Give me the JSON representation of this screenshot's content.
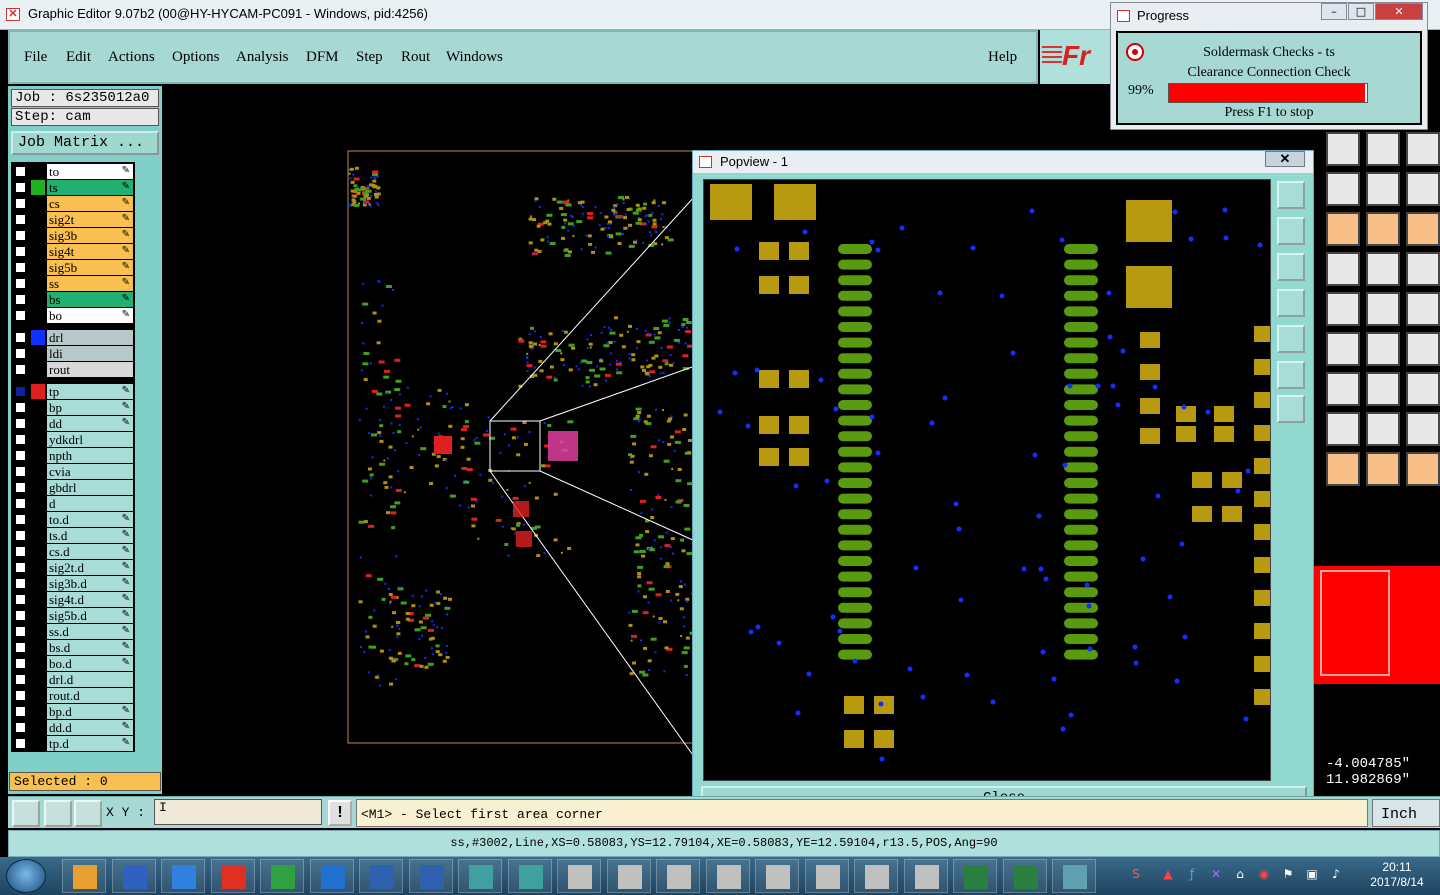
{
  "window": {
    "title": "Graphic Editor 9.07b2 (00@HY-HYCAM-PC091 - Windows, pid:4256)"
  },
  "menu": {
    "items": [
      {
        "label": "File"
      },
      {
        "label": "Edit"
      },
      {
        "label": "Actions"
      },
      {
        "label": "Options"
      },
      {
        "label": "Analysis"
      },
      {
        "label": "DFM"
      },
      {
        "label": "Step"
      },
      {
        "label": "Rout"
      },
      {
        "label": "Windows"
      }
    ],
    "help": "Help",
    "logo": "Fr"
  },
  "job": {
    "job_line": "Job : 6s235012a0",
    "step_line": "Step: cam",
    "job_matrix": "Job Matrix ..."
  },
  "layers": [
    {
      "name": "to",
      "color": "#ffffff",
      "swatch": "#000000",
      "pen": true
    },
    {
      "name": "ts",
      "color": "#20b070",
      "swatch": "#20b020",
      "pen": true
    },
    {
      "name": "cs",
      "color": "#f8c050",
      "swatch": "#000000",
      "pen": true
    },
    {
      "name": "sig2t",
      "color": "#f8c050",
      "swatch": "#000000",
      "pen": true
    },
    {
      "name": "sig3b",
      "color": "#f8c050",
      "swatch": "#000000",
      "pen": true
    },
    {
      "name": "sig4t",
      "color": "#f8c050",
      "swatch": "#000000",
      "pen": true
    },
    {
      "name": "sig5b",
      "color": "#f8c050",
      "swatch": "#000000",
      "pen": true
    },
    {
      "name": "ss",
      "color": "#f8c050",
      "swatch": "#000000",
      "pen": true
    },
    {
      "name": "bs",
      "color": "#20b070",
      "swatch": "#000000",
      "pen": true
    },
    {
      "name": "bo",
      "color": "#ffffff",
      "swatch": "#000000",
      "pen": true
    },
    {
      "name": "drl",
      "color": "#b8c8c8",
      "swatch": "#1030ff",
      "pen": false,
      "gap": true
    },
    {
      "name": "ldi",
      "color": "#b8c8c8",
      "swatch": "#000000",
      "pen": false
    },
    {
      "name": "rout",
      "color": "#d8d8d8",
      "swatch": "#000000",
      "pen": false
    },
    {
      "name": "tp",
      "color": "#a8dcd6",
      "swatch": "#e02020",
      "pen": true,
      "gap": true,
      "active": true
    },
    {
      "name": "bp",
      "color": "#a8dcd6",
      "swatch": "#000000",
      "pen": true
    },
    {
      "name": "dd",
      "color": "#a8dcd6",
      "swatch": "#000000",
      "pen": true
    },
    {
      "name": "ydkdrl",
      "color": "#a8dcd6",
      "swatch": "#000000",
      "pen": false
    },
    {
      "name": "npth",
      "color": "#a8dcd6",
      "swatch": "#000000",
      "pen": false
    },
    {
      "name": "cvia",
      "color": "#a8dcd6",
      "swatch": "#000000",
      "pen": false
    },
    {
      "name": "gbdrl",
      "color": "#a8dcd6",
      "swatch": "#000000",
      "pen": false
    },
    {
      "name": "d",
      "color": "#a8dcd6",
      "swatch": "#000000",
      "pen": false
    },
    {
      "name": "to.d",
      "color": "#a8dcd6",
      "swatch": "#000000",
      "pen": true
    },
    {
      "name": "ts.d",
      "color": "#a8dcd6",
      "swatch": "#000000",
      "pen": true
    },
    {
      "name": "cs.d",
      "color": "#a8dcd6",
      "swatch": "#000000",
      "pen": true
    },
    {
      "name": "sig2t.d",
      "color": "#a8dcd6",
      "swatch": "#000000",
      "pen": true
    },
    {
      "name": "sig3b.d",
      "color": "#a8dcd6",
      "swatch": "#000000",
      "pen": true
    },
    {
      "name": "sig4t.d",
      "color": "#a8dcd6",
      "swatch": "#000000",
      "pen": true
    },
    {
      "name": "sig5b.d",
      "color": "#a8dcd6",
      "swatch": "#000000",
      "pen": true
    },
    {
      "name": "ss.d",
      "color": "#a8dcd6",
      "swatch": "#000000",
      "pen": true
    },
    {
      "name": "bs.d",
      "color": "#a8dcd6",
      "swatch": "#000000",
      "pen": true
    },
    {
      "name": "bo.d",
      "color": "#a8dcd6",
      "swatch": "#000000",
      "pen": true
    },
    {
      "name": "drl.d",
      "color": "#a8dcd6",
      "swatch": "#000000",
      "pen": false
    },
    {
      "name": "rout.d",
      "color": "#a8dcd6",
      "swatch": "#000000",
      "pen": false
    },
    {
      "name": "bp.d",
      "color": "#a8dcd6",
      "swatch": "#000000",
      "pen": true
    },
    {
      "name": "dd.d",
      "color": "#a8dcd6",
      "swatch": "#000000",
      "pen": true
    },
    {
      "name": "tp.d",
      "color": "#a8dcd6",
      "swatch": "#000000",
      "pen": true
    }
  ],
  "selected": "Selected : 0",
  "progress": {
    "title": "Progress",
    "line1": "Soldermask Checks - ts",
    "line2": "Clearance Connection Check",
    "percent_text": "99%",
    "percent": 0.99,
    "stop_hint": "Press F1 to stop"
  },
  "popview": {
    "title": "Popview - 1",
    "close_label": "Close"
  },
  "coords": {
    "x": "-4.004785\"",
    "y": "11.982869\""
  },
  "input": {
    "xy_label": "X Y :",
    "xy_value": "I",
    "prompt": "<M1> - Select first area corner",
    "units": "Inch"
  },
  "status_line": "ss,#3002,Line,XS=0.58083,YS=12.79104,XE=0.58083,YE=12.59104,r13.5,POS,Ang=90",
  "clock": {
    "time": "20:11",
    "date": "2017/8/14"
  }
}
